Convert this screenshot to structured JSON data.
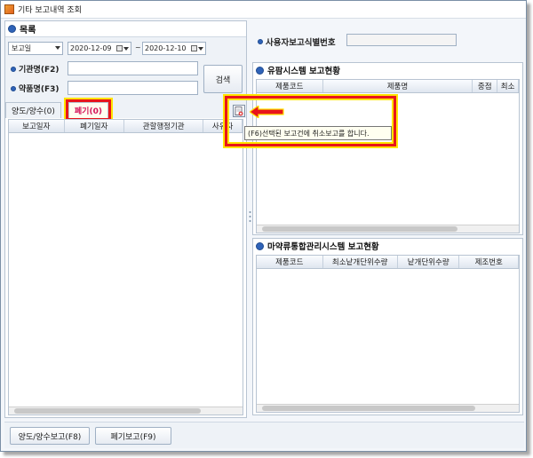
{
  "window": {
    "title": "기타 보고내역 조회"
  },
  "left": {
    "section_title": "목록",
    "date_type": "보고일",
    "date_from": "2020-12-09",
    "tilde": "~",
    "date_to": "2020-12-10",
    "org_label": "기관명(F2)",
    "drug_label": "약품명(F3)",
    "org_value": "",
    "drug_value": "",
    "search_button": "검색",
    "tabs": [
      {
        "label": "양도/양수(0)"
      },
      {
        "label": "폐기(0)"
      }
    ],
    "columns": [
      "보고일자",
      "폐기일자",
      "관할행정기관",
      "사유자"
    ]
  },
  "right": {
    "id_label": "사용자보고식별번호",
    "id_value": "",
    "top_title": "유팜시스템 보고현황",
    "top_columns": [
      "제품코드",
      "제품명",
      "중점",
      "최소"
    ],
    "bottom_title": "마약류통합관리시스템 보고현황",
    "bottom_columns": [
      "제품코드",
      "최소낱개단위수량",
      "낱개단위수량",
      "제조번호"
    ]
  },
  "tooltip": "(F6)선택된 보고건에 취소보고를 합니다.",
  "buttons": {
    "transfer": "양도/양수보고(F8)",
    "disposal": "폐기보고(F9)"
  },
  "colors": {
    "highlight_red": "#e8151b",
    "highlight_yellow": "#ffe400",
    "tab_text": "#d4145a"
  }
}
